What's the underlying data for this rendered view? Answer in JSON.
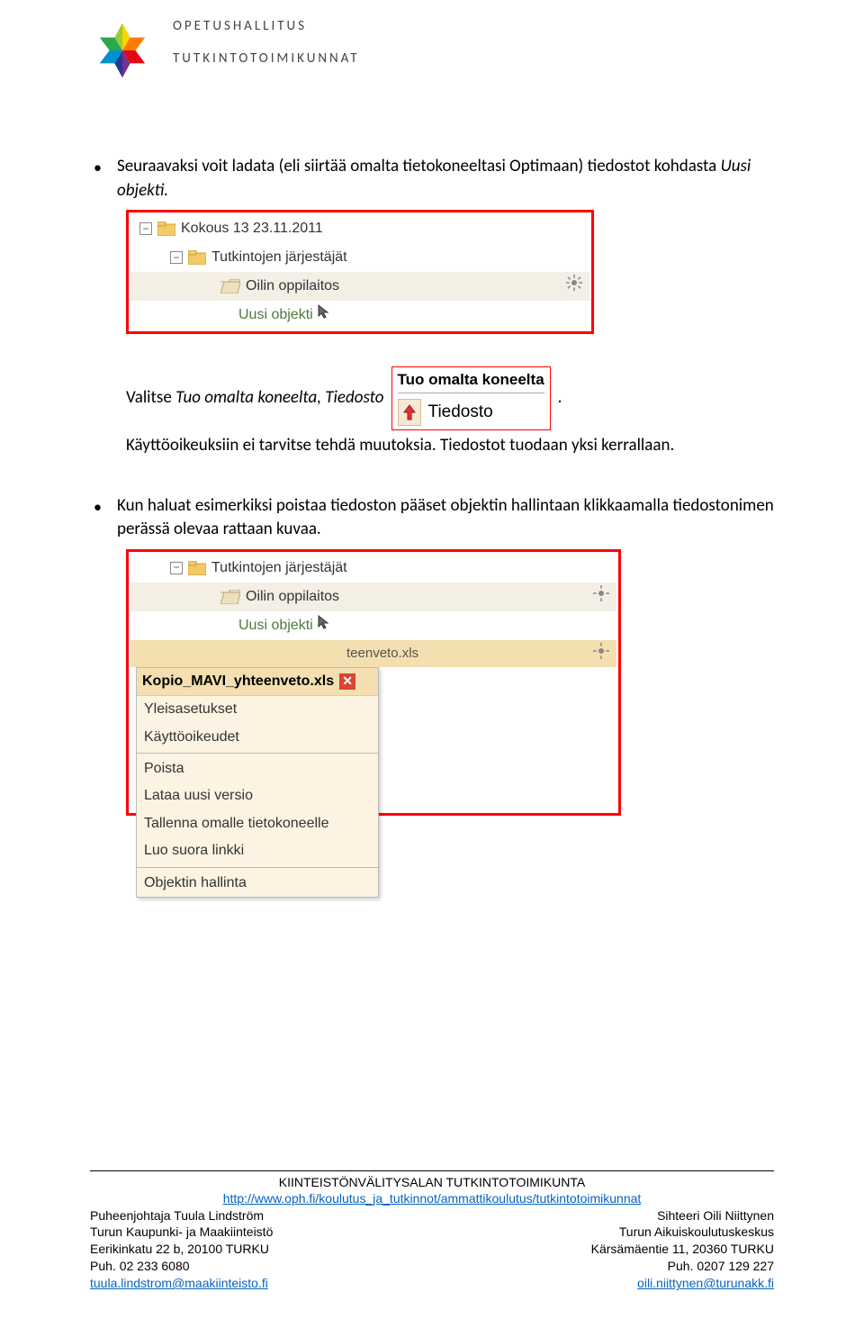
{
  "header": {
    "org1": "OPETUSHALLITUS",
    "org2": "TUTKINTOTOIMIKUNNAT"
  },
  "body": {
    "bullet1_pre": "Seuraavaksi voit ladata (eli siirtää omalta tietokoneeltasi Optimaan) tiedostot kohdasta ",
    "bullet1_em": "Uusi objekti.",
    "tree1": {
      "root": "Kokous 13 23.11.2011",
      "child1": "Tutkintojen järjestäjät",
      "child2": "Oilin oppilaitos",
      "new_obj": "Uusi objekti"
    },
    "valitse_pre": "Valitse ",
    "valitse_em": "Tuo omalta koneelta, Tiedosto",
    "tuo_title": "Tuo omalta koneelta",
    "tuo_item": "Tiedosto",
    "line3a": "Käyttöoikeuksiin ei tarvitse tehdä muutoksia. Tiedostot tuodaan yksi kerrallaan.",
    "bullet2": "Kun haluat esimerkiksi poistaa tiedoston pääset objektin hallintaan klikkaamalla tiedostonimen perässä olevaa rattaan kuvaa.",
    "tree2": {
      "child1": "Tutkintojen järjestäjät",
      "child2": "Oilin oppilaitos",
      "new_obj": "Uusi objekti",
      "file_bg": "teenveto.xls"
    },
    "menu": {
      "title": "Kopio_MAVI_yhteenveto.xls",
      "items": [
        "Yleisasetukset",
        "Käyttöoikeudet",
        "Poista",
        "Lataa uusi versio",
        "Tallenna omalle tietokoneelle",
        "Luo suora linkki",
        "Objektin hallinta"
      ]
    }
  },
  "footer": {
    "title": "KIINTEISTÖNVÄLITYSALAN TUTKINTOTOIMIKUNTA",
    "url": "http://www.oph.fi/koulutus_ja_tutkinnot/ammattikoulutus/tutkintotoimikunnat",
    "left": {
      "l1": "Puheenjohtaja Tuula Lindström",
      "l2": "Turun Kaupunki- ja Maakiinteistö",
      "l3": "Eerikinkatu 22 b, 20100 TURKU",
      "l4": "Puh. 02 233 6080",
      "l5": "tuula.lindstrom@maakiinteisto.fi"
    },
    "right": {
      "r1": "Sihteeri Oili Niittynen",
      "r2": "Turun Aikuiskoulutuskeskus",
      "r3": "Kärsämäentie 11, 20360 TURKU",
      "r4": "Puh.  0207 129 227",
      "r5": "oili.niittynen@turunakk.fi"
    }
  }
}
